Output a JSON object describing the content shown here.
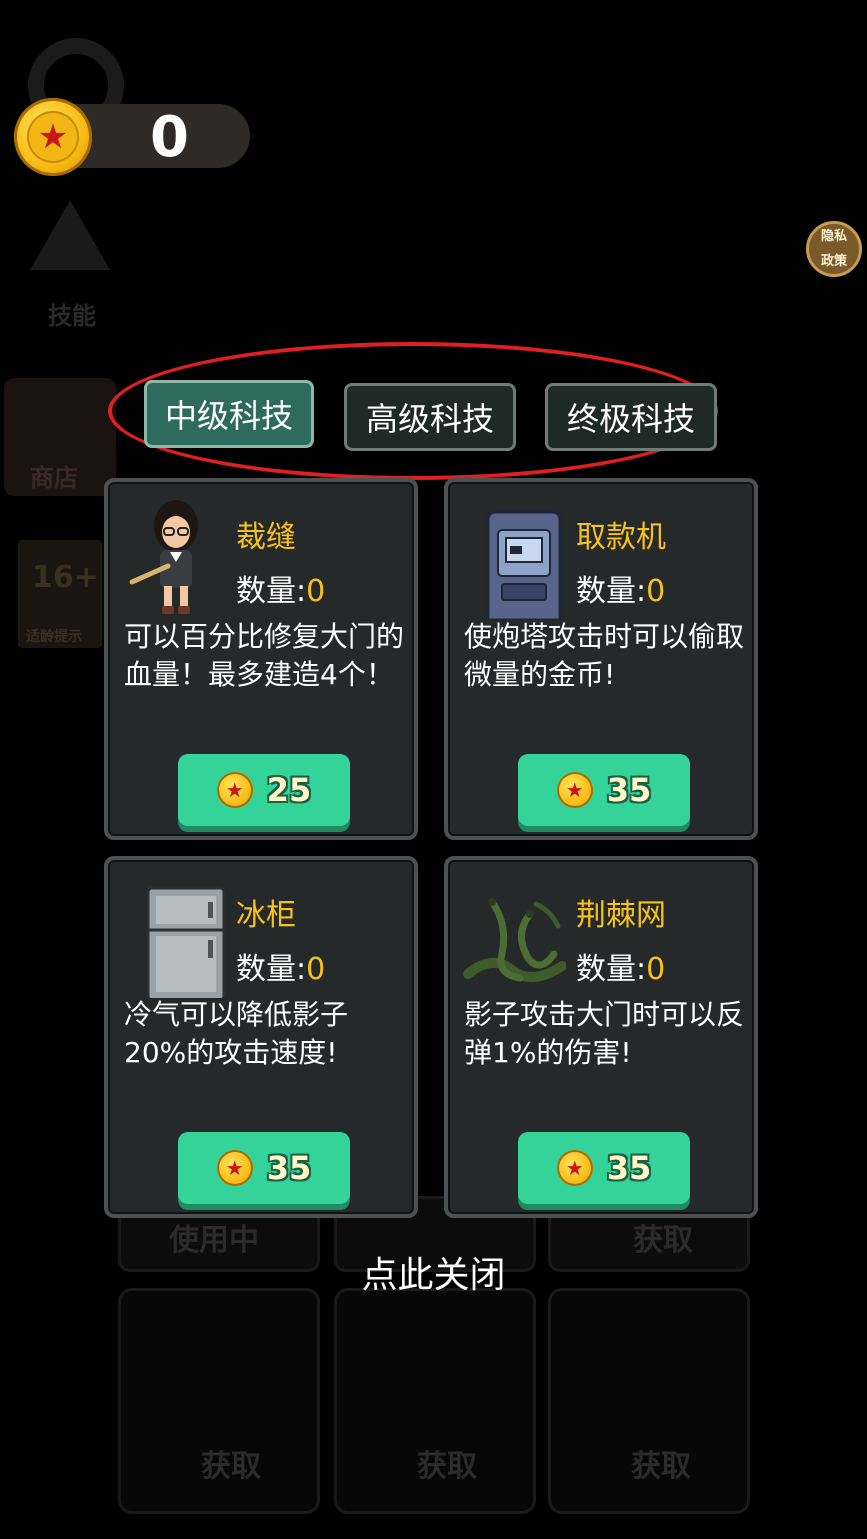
{
  "hud": {
    "coins": "0"
  },
  "privacy": {
    "line1": "隐私",
    "line2": "政策"
  },
  "background": {
    "skill_label": "技能",
    "shop_label": "商店",
    "age_label": "适龄提示",
    "age_value": "16+",
    "using_label": "使用中",
    "get_label": "获取"
  },
  "tabs": [
    {
      "label": "中级科技",
      "active": true
    },
    {
      "label": "高级科技",
      "active": false
    },
    {
      "label": "终极科技",
      "active": false
    }
  ],
  "items": [
    {
      "name": "裁缝",
      "qty_label": "数量:",
      "qty": "0",
      "desc": "可以百分比修复大门的血量！最多建造4个！",
      "price": "25",
      "icon": "tailor-character-icon"
    },
    {
      "name": "取款机",
      "qty_label": "数量:",
      "qty": "0",
      "desc": "使炮塔攻击时可以偷取微量的金币!",
      "price": "35",
      "icon": "atm-machine-icon"
    },
    {
      "name": "冰柜",
      "qty_label": "数量:",
      "qty": "0",
      "desc": "冷气可以降低影子20%的攻击速度!",
      "price": "35",
      "icon": "freezer-icon"
    },
    {
      "name": "荆棘网",
      "qty_label": "数量:",
      "qty": "0",
      "desc": "影子攻击大门时可以反弹1%的伤害!",
      "price": "35",
      "icon": "thorn-vine-icon"
    }
  ],
  "close_label": "点此关闭",
  "colors": {
    "accent_yellow": "#f5c21c",
    "buy_green": "#34d39a",
    "tab_active": "#2e6b5e",
    "highlight_ring": "#e02020"
  }
}
